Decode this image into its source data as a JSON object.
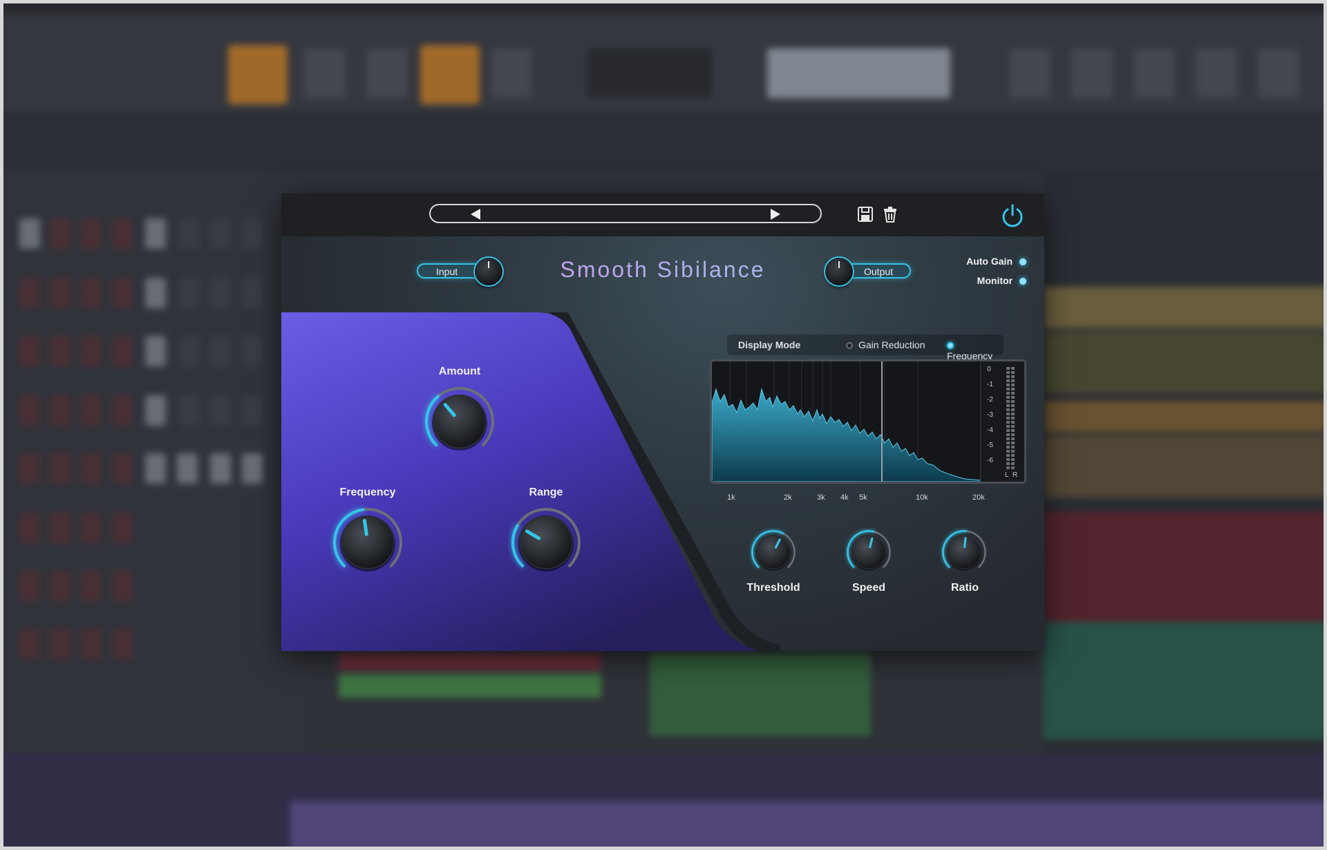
{
  "preset": {
    "prev_label": "previous preset",
    "next_label": "next preset",
    "save_icon": "save-icon",
    "delete_icon": "trash-icon",
    "power_icon": "power-icon"
  },
  "plugin": {
    "title": "Smooth Sibilance",
    "input_label": "Input",
    "output_label": "Output",
    "auto_gain_label": "Auto Gain",
    "monitor_label": "Monitor",
    "accent_color": "#35c4e8"
  },
  "knobs": {
    "amount": {
      "label": "Amount",
      "value": 0.35
    },
    "frequency": {
      "label": "Frequency",
      "value": 0.47
    },
    "range": {
      "label": "Range",
      "value": 0.28
    },
    "threshold": {
      "label": "Threshold",
      "value": 0.6
    },
    "speed": {
      "label": "Speed",
      "value": 0.55
    },
    "ratio": {
      "label": "Ratio",
      "value": 0.52
    }
  },
  "display": {
    "mode_label": "Display Mode",
    "options": [
      "Gain Reduction",
      "Frequency"
    ],
    "selected": "Frequency",
    "db_ticks": [
      "0",
      "-1",
      "-2",
      "-3",
      "-4",
      "-5",
      "-6"
    ],
    "channels": [
      "L",
      "R"
    ],
    "freq_ticks": [
      "1k",
      "2k",
      "3k",
      "4k",
      "5k",
      "10k",
      "20k"
    ]
  }
}
